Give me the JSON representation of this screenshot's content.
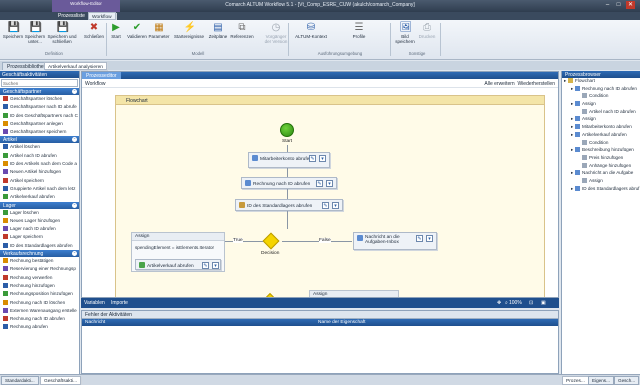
{
  "window": {
    "title": "Comarch ALTUM Workflow 5.1 - [Vt_Comp_ESRE_CUW (akulch/comarch_Company]",
    "context_tab": "Workflow-Editor",
    "min": "–",
    "max": "□",
    "close": "✕"
  },
  "ribbon_tabs": [
    "Prozessliste",
    "Workflow"
  ],
  "ribbon": {
    "buttons": [
      {
        "label": "Speichern",
        "icon": "💾",
        "color": "#2b5da8",
        "disabled": false
      },
      {
        "label": "Speichern unter...",
        "icon": "💾",
        "color": "#2b5da8",
        "disabled": false
      },
      {
        "label": "Speichern und schließen",
        "icon": "💾",
        "color": "#2b5da8",
        "disabled": false
      },
      {
        "label": "Schließen",
        "icon": "✖",
        "color": "#c0392b",
        "disabled": false
      },
      {
        "label": "Start",
        "icon": "▶",
        "color": "#2e9d2e",
        "disabled": false
      },
      {
        "label": "Validieren",
        "icon": "✔",
        "color": "#2e9d2e",
        "disabled": false
      },
      {
        "label": "Parameter",
        "icon": "▦",
        "color": "#c07a10",
        "disabled": false
      },
      {
        "label": "Startereignisse",
        "icon": "⚡",
        "color": "#d98c00",
        "disabled": false
      },
      {
        "label": "Zeitpläne",
        "icon": "▤",
        "color": "#2b5da8",
        "disabled": false
      },
      {
        "label": "Referenzen",
        "icon": "⧉",
        "color": "#6b6b6b",
        "disabled": false
      },
      {
        "label": "Vorgänger der Version",
        "icon": "◷",
        "color": "#9aa3ad",
        "disabled": true
      },
      {
        "label": "ALTUM-Kontext",
        "icon": "⛁",
        "color": "#2b5da8",
        "disabled": false
      },
      {
        "label": "Profile",
        "icon": "☰",
        "color": "#6b6b6b",
        "disabled": false
      },
      {
        "label": "Bild speichern",
        "icon": "🖼",
        "color": "#2b5da8",
        "disabled": false
      },
      {
        "label": "Drucken",
        "icon": "⎙",
        "color": "#9aa3ad",
        "disabled": true
      }
    ],
    "groups": [
      "Definition",
      "Modell",
      "Ausführungsumgebung",
      "Sonstige"
    ]
  },
  "doc_tabs": [
    "Prozessbibliothek",
    "Artikelverkauf analysieren"
  ],
  "toolbox": {
    "title": "Geschäftsaktivitäten",
    "search_placeholder": "Suchen",
    "categories": [
      {
        "name": "Geschäftspartner",
        "items": [
          "Geschäftspartner löschen",
          "Geschäftspartner nach ID abrufe",
          "ID des Geschäftspartners nach C",
          "Geschäftspartner anlegen",
          "Geschäftspartner speichern"
        ]
      },
      {
        "name": "Artikel",
        "items": [
          "Artikel löschen",
          "Artikel nach ID abrufen",
          "ID des Artikels nach dem Code a",
          "Neuen Artikel hinzufügen",
          "Artikel speichern",
          "Gruppierte Artikel nach dem letz",
          "Artikelverkauf abrufen"
        ]
      },
      {
        "name": "Lager",
        "items": [
          "Lager löschen",
          "Neues Lager hinzufügen",
          "Lager nach ID abrufen",
          "Lager speichern",
          "ID des Standardlagers abrufen"
        ]
      },
      {
        "name": "Verkaufsrechnung",
        "items": [
          "Rechnung bestätigen",
          "Reservierung einer Rechnungsp",
          "Rechnung verwerfen",
          "Rechnung hinzufügen",
          "Rechnungsposition hinzufügen",
          "Rechnung nach ID löschen",
          "Externen Warenausgang erstelle",
          "Rechnung nach ID abrufen",
          "Rechnung abrufen"
        ]
      }
    ]
  },
  "designer": {
    "tab": "Prozesseditor",
    "breadcrumb": "Workflow",
    "expand_all": "Alle erweitern",
    "restore_all": "Wiederherstellen",
    "flowchart_label": "Flowchart",
    "start_label": "Start",
    "activities": {
      "a1": "Mitarbeiterkonto abrufen",
      "a2": "Rechnung nach ID abrufen",
      "a3": "ID des Standardlagers abrufen",
      "assign_label": "Assign",
      "assign_left": "spendingElement",
      "assign_op": "=",
      "assign_right": "isElements.Iterator",
      "a5": "Artikelverkauf abrufen",
      "decision": "Decision",
      "true_label": "True",
      "false_label": "False",
      "a6": "Nachricht an die Aufgaben-Inbox",
      "assign2": "Assign"
    },
    "bottom": {
      "variables": "Variablen",
      "imports": "Importe",
      "zoom": "100%"
    }
  },
  "errors": {
    "title": "Fehler der Aktivitäten",
    "col_name": "Nachricht",
    "col_prop": "Name der Eigenschaft"
  },
  "properties": {
    "title": "Prozessbrowser",
    "tree": [
      {
        "text": "Flowchart",
        "level": 0,
        "exp": "▸"
      },
      {
        "text": "Rechnung nach ID abrufen",
        "level": 1,
        "exp": "▸"
      },
      {
        "text": "Condition",
        "level": 2,
        "exp": ""
      },
      {
        "text": "Assign",
        "level": 1,
        "exp": "▸"
      },
      {
        "text": "Artikel nach ID abrufen",
        "level": 2,
        "exp": ""
      },
      {
        "text": "Assign",
        "level": 1,
        "exp": "▸"
      },
      {
        "text": "Mitarbeiterkonto abrufen",
        "level": 1,
        "exp": "▸"
      },
      {
        "text": "Artikelverkauf abrufen",
        "level": 1,
        "exp": "▸"
      },
      {
        "text": "Condition",
        "level": 2,
        "exp": ""
      },
      {
        "text": "Beschreibung hinzufügen",
        "level": 1,
        "exp": "▸"
      },
      {
        "text": "Preis hinzufügen",
        "level": 2,
        "exp": ""
      },
      {
        "text": "Anhänge hinzufügen",
        "level": 2,
        "exp": ""
      },
      {
        "text": "Nachricht an die Aufgabe",
        "level": 1,
        "exp": "▸"
      },
      {
        "text": "Assign",
        "level": 2,
        "exp": ""
      },
      {
        "text": "ID des Standardlagers abruf",
        "level": 1,
        "exp": "▸"
      }
    ]
  },
  "bottom_tabs_left": [
    "Standardakti...",
    "Geschäftsakti..."
  ],
  "bottom_tabs_right": [
    "Prozes...",
    "Eigens...",
    "Gesch..."
  ]
}
